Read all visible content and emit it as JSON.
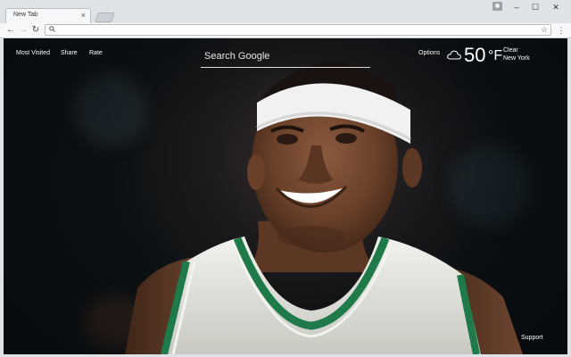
{
  "browser": {
    "tab_title": "New Tab",
    "tab_close": "×",
    "window_minimize": "–",
    "window_maximize": "☐",
    "window_close": "✕",
    "omnibox_value": "",
    "omnibox_icon": "magnifier-icon",
    "bookmark_star": "☆",
    "menu_glyph": "⋮",
    "back_glyph": "←",
    "forward_glyph": "→",
    "reload_glyph": "↻"
  },
  "newtab": {
    "links": {
      "most_visited": "Most Visited",
      "share": "Share",
      "rate": "Rate"
    },
    "search": {
      "placeholder": "Search Google"
    },
    "options_label": "Options",
    "weather": {
      "temperature": "50",
      "unit": "°F",
      "condition": "Clear",
      "location": "New York",
      "icon": "cloud-icon"
    },
    "support_label": "Support"
  },
  "colors": {
    "chrome_frame": "#dfe3e8",
    "toolbar": "#f6f7f8",
    "overlay_text": "#ffffff",
    "jersey_green": "#1f7a4a"
  }
}
